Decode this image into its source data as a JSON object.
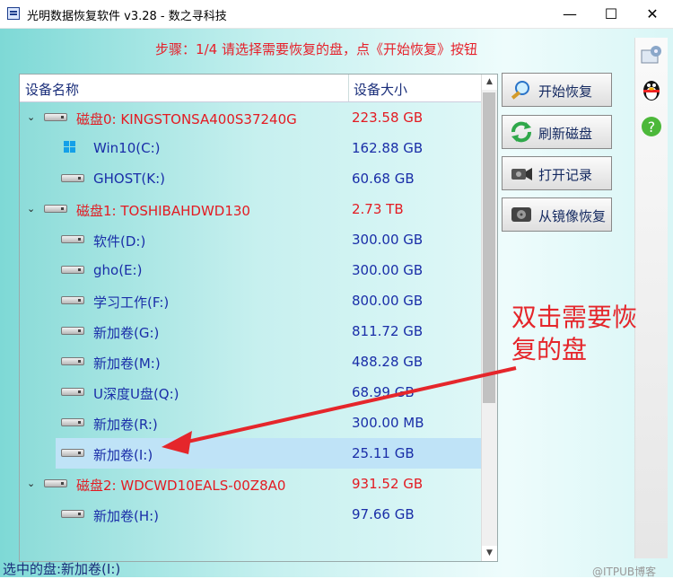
{
  "window": {
    "title": "光明数据恢复软件 v3.28 - 数之寻科技",
    "min": "—",
    "max": "☐",
    "close": "✕"
  },
  "step": "步骤：1/4 请选择需要恢复的盘，点《开始恢复》按钮",
  "table": {
    "col_name": "设备名称",
    "col_size": "设备大小",
    "rows": [
      {
        "kind": "disk",
        "name": "磁盘0: KINGSTONSA400S37240G",
        "size": "223.58 GB"
      },
      {
        "kind": "part",
        "name": "Win10(C:)",
        "size": "162.88 GB",
        "icon": "windows-icon"
      },
      {
        "kind": "part",
        "name": "GHOST(K:)",
        "size": "60.68 GB"
      },
      {
        "kind": "disk",
        "name": "磁盘1: TOSHIBAHDWD130",
        "size": "2.73 TB"
      },
      {
        "kind": "part",
        "name": " 软件(D:)",
        "size": "300.00 GB"
      },
      {
        "kind": "part",
        "name": "gho(E:)",
        "size": "300.00 GB"
      },
      {
        "kind": "part",
        "name": "学习工作(F:)",
        "size": "800.00 GB"
      },
      {
        "kind": "part",
        "name": "新加卷(G:)",
        "size": "811.72 GB"
      },
      {
        "kind": "part",
        "name": "新加卷(M:)",
        "size": "488.28 GB"
      },
      {
        "kind": "part",
        "name": "U深度U盘(Q:)",
        "size": "68.99 GB"
      },
      {
        "kind": "part",
        "name": "新加卷(R:)",
        "size": "300.00 MB"
      },
      {
        "kind": "part",
        "name": "新加卷(I:)",
        "size": "25.11 GB",
        "selected": true
      },
      {
        "kind": "disk",
        "name": "磁盘2: WDCWD10EALS-00Z8A0",
        "size": "931.52 GB"
      },
      {
        "kind": "part",
        "name": "新加卷(H:)",
        "size": "97.66 GB"
      }
    ]
  },
  "buttons": {
    "start": "开始恢复",
    "refresh": "刷新磁盘",
    "open_log": "打开记录",
    "from_image": "从镜像恢复"
  },
  "annotation": "双击需要恢复的盘",
  "status": "选中的盘:新加卷(I:)",
  "watermark": "@ITPUB博客",
  "colors": {
    "disk_text": "#e31b22",
    "part_text": "#1a2ea8",
    "annotation": "#e5262b"
  }
}
